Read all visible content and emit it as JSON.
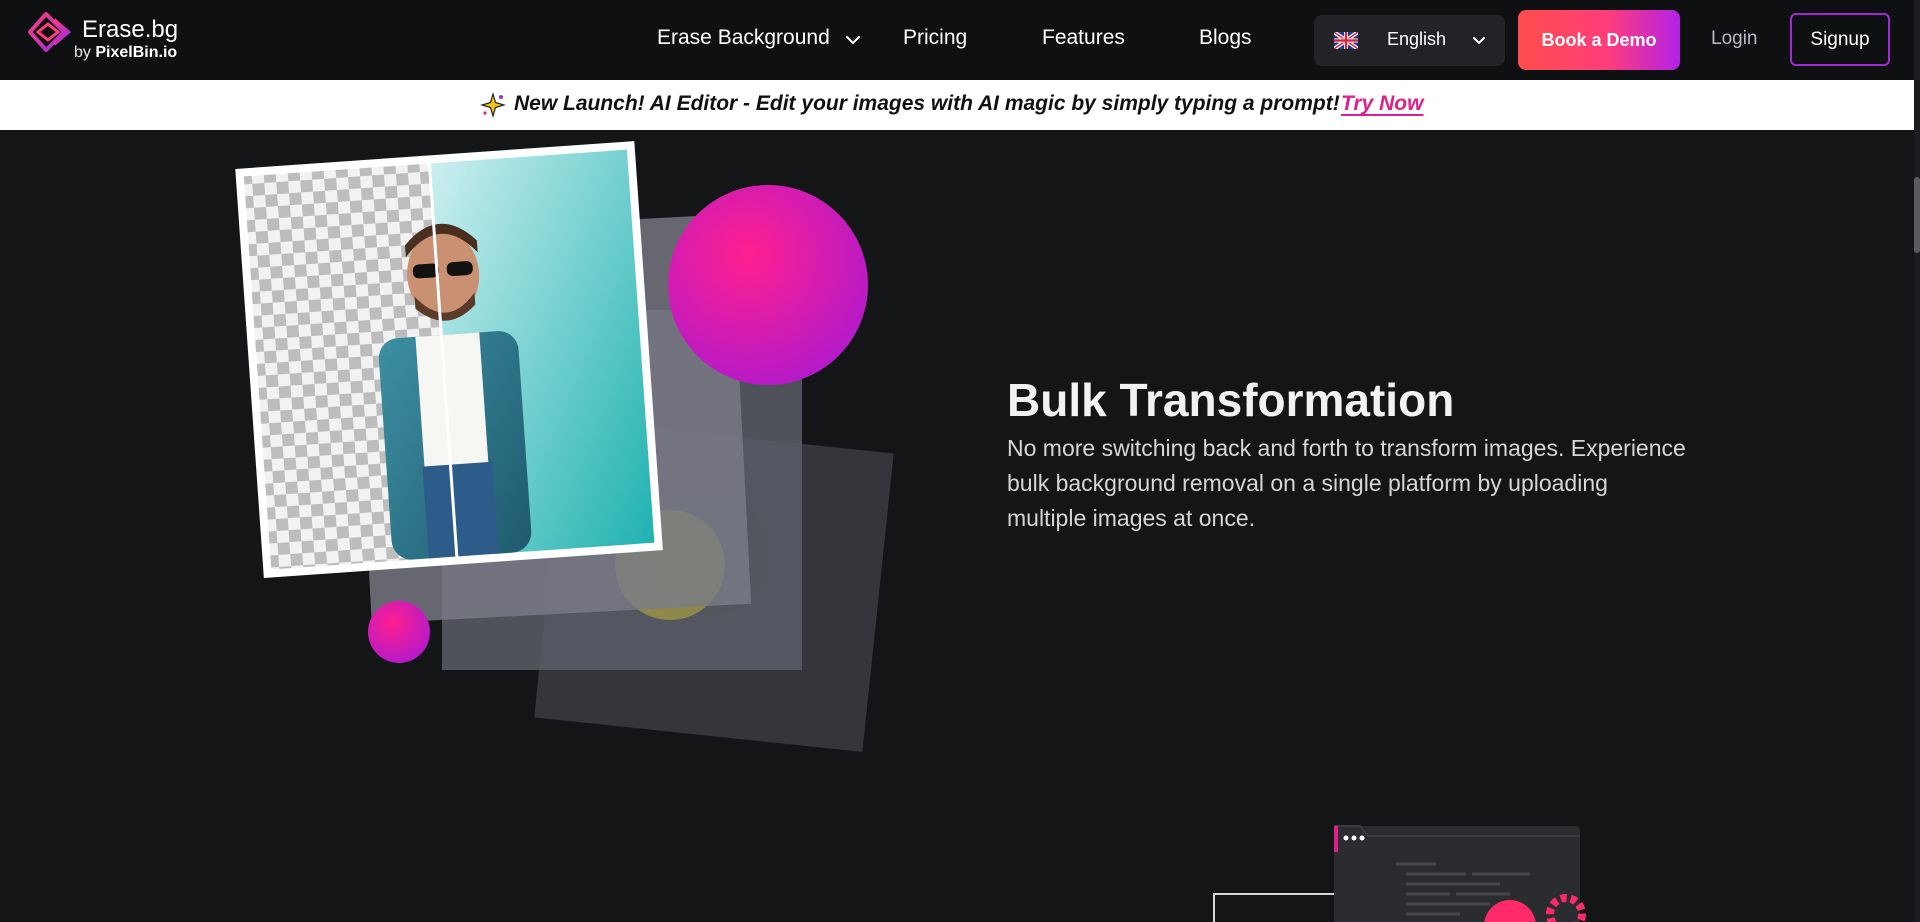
{
  "navbar": {
    "logo_title": "Erase.bg",
    "logo_sub_prefix": "by",
    "logo_sub_brand": "PixelBin.io",
    "items": [
      {
        "label": "Erase Background",
        "has_dropdown": true
      },
      {
        "label": "Pricing"
      },
      {
        "label": "Features"
      },
      {
        "label": "Blogs"
      }
    ],
    "language": {
      "label": "English",
      "flag_icon": "uk-flag-icon"
    },
    "demo_button": "Book a Demo",
    "login": "Login",
    "signup": "Signup"
  },
  "banner": {
    "icon": "sparkle-star-icon",
    "text": "New Launch! AI Editor - Edit your images with AI magic by simply typing a prompt!",
    "link": "Try Now"
  },
  "feature": {
    "title": "Bulk Transformation",
    "description": "No more switching back and forth to transform images. Experience bulk background removal on a single platform by uploading multiple images at once."
  },
  "colors": {
    "nav_bg": "#0f1012",
    "page_bg": "#141517",
    "accent_pink": "#e0208a",
    "accent_purple": "#a12ad6",
    "demo_gradient_start": "#ff4d4d",
    "demo_gradient_end": "#b322e6"
  }
}
